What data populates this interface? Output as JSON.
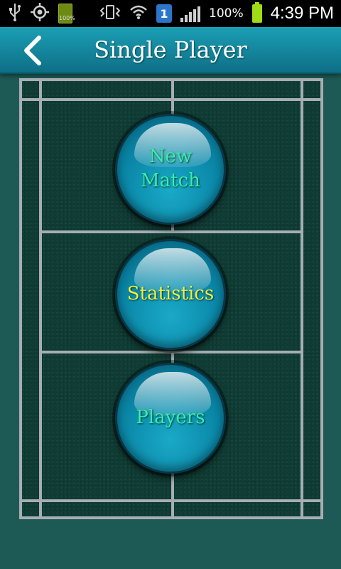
{
  "status_bar": {
    "battery_small_label": "100%",
    "notification_count": "1",
    "battery_percent": "100%",
    "time": "4:39 PM"
  },
  "header": {
    "title": "Single Player"
  },
  "menu": {
    "new_match_line1": "New",
    "new_match_line2": "Match",
    "statistics": "Statistics",
    "players": "Players"
  },
  "colors": {
    "header_bg": "#1a9fb5",
    "court_bg": "#0f3d35",
    "court_lines": "#a6aeb3",
    "button_blue": "#0a86a6",
    "label_green": "#35f0a8",
    "label_yellow": "#f1f03a"
  },
  "icons": [
    "usb-icon",
    "gps-icon",
    "battery-icon",
    "vibrate-icon",
    "wifi-icon",
    "notification-icon",
    "signal-icon",
    "back-arrow-icon"
  ]
}
